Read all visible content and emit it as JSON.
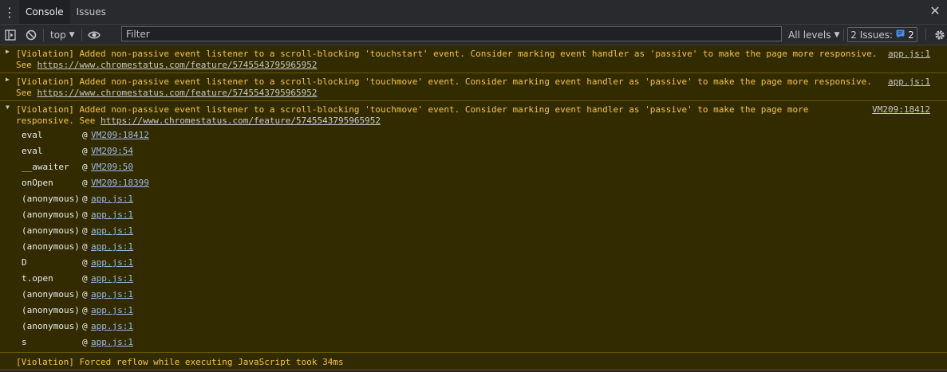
{
  "tabs": [
    {
      "label": "Console"
    },
    {
      "label": "Issues"
    }
  ],
  "toolbar": {
    "context": "top",
    "filter_placeholder": "Filter",
    "levels": "All levels",
    "issues_label": "2 Issues:",
    "issues_count": "2"
  },
  "messages": [
    {
      "prefix": "[Violation] Added non-passive event listener to a scroll-blocking 'touchstart' event. Consider marking event handler as 'passive' to make the page more responsive.",
      "see": "See ",
      "url": "https://www.chromestatus.com/feature/5745543795965952",
      "source": "app.js:1"
    },
    {
      "prefix": "[Violation] Added non-passive event listener to a scroll-blocking 'touchmove' event. Consider marking event handler as 'passive' to make the page more responsive.",
      "see": "See ",
      "url": "https://www.chromestatus.com/feature/5745543795965952",
      "source": "app.js:1"
    },
    {
      "line1": "[Violation] Added non-passive event listener to a scroll-blocking 'touchmove' event. Consider marking event handler as 'passive' to make the page more",
      "line2": "responsive. See ",
      "url": "https://www.chromestatus.com/feature/5745543795965952",
      "source": "VM209:18412",
      "stack": [
        {
          "fn": "eval",
          "loc": "VM209:18412"
        },
        {
          "fn": "eval",
          "loc": "VM209:54"
        },
        {
          "fn": "__awaiter",
          "loc": "VM209:50"
        },
        {
          "fn": "onOpen",
          "loc": "VM209:18399"
        },
        {
          "fn": "(anonymous)",
          "loc": "app.js:1"
        },
        {
          "fn": "(anonymous)",
          "loc": "app.js:1"
        },
        {
          "fn": "(anonymous)",
          "loc": "app.js:1"
        },
        {
          "fn": "(anonymous)",
          "loc": "app.js:1"
        },
        {
          "fn": "D",
          "loc": "app.js:1"
        },
        {
          "fn": "t.open",
          "loc": "app.js:1"
        },
        {
          "fn": "(anonymous)",
          "loc": "app.js:1"
        },
        {
          "fn": "(anonymous)",
          "loc": "app.js:1"
        },
        {
          "fn": "(anonymous)",
          "loc": "app.js:1"
        },
        {
          "fn": "s",
          "loc": "app.js:1"
        }
      ]
    },
    {
      "text": "[Violation] Forced reflow while executing JavaScript took 34ms"
    }
  ],
  "at_symbol": "@"
}
